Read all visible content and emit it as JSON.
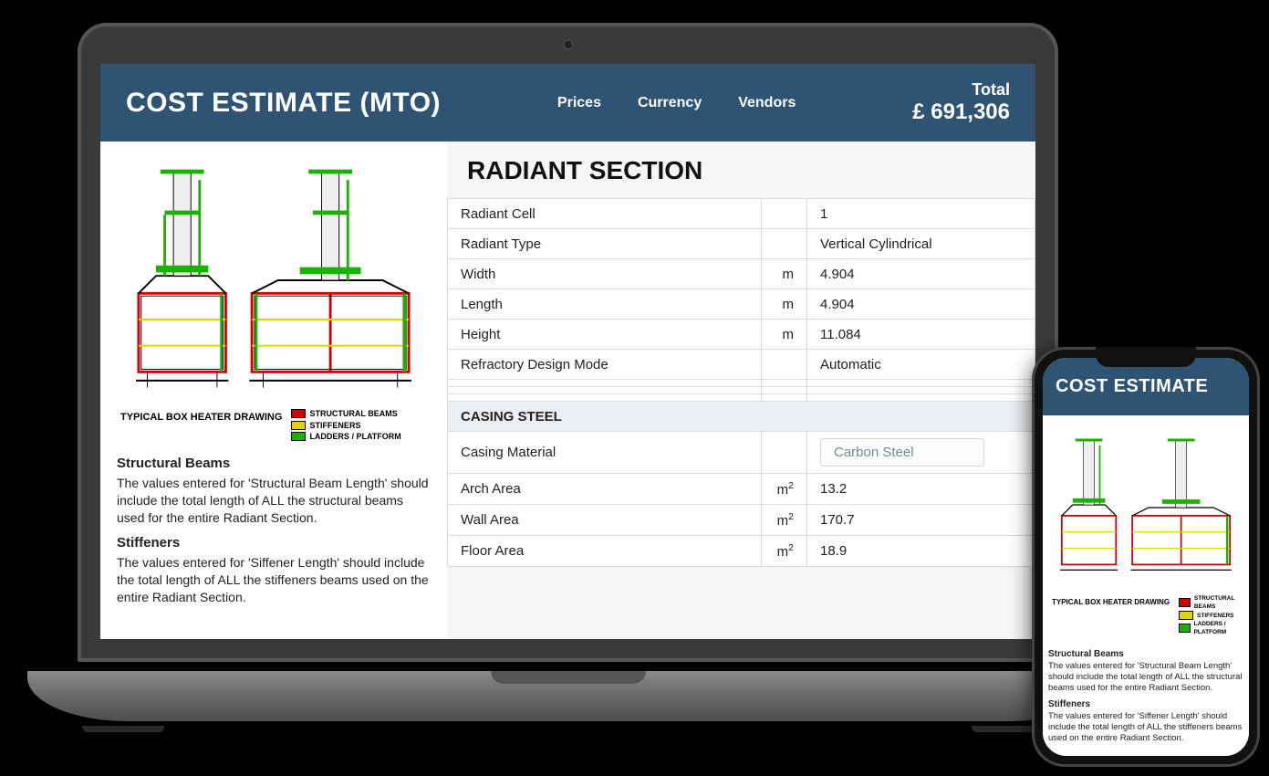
{
  "header": {
    "title": "COST ESTIMATE (MTO)",
    "title_short": "COST ESTIMATE",
    "nav": {
      "prices": "Prices",
      "currency": "Currency",
      "vendors": "Vendors"
    },
    "total_label": "Total",
    "total_value": "£ 691,306"
  },
  "drawing": {
    "caption": "TYPICAL BOX HEATER DRAWING",
    "legend": {
      "beams": "STRUCTURAL BEAMS",
      "stiffeners": "STIFFENERS",
      "ladders": "LADDERS / PLATFORM"
    },
    "colors": {
      "beams": "#d40000",
      "stiffeners": "#e0d400",
      "ladders": "#19b200"
    }
  },
  "help": {
    "beams_title": "Structural Beams",
    "beams_text": "The values entered for 'Structural Beam Length' should include the total length of ALL the structural beams used for the entire Radiant Section.",
    "stiff_title": "Stiffeners",
    "stiff_text": "The values entered for 'Siffener Length' should include the total length of ALL the stiffeners beams used on the entire Radiant Section."
  },
  "section": {
    "title": "RADIANT SECTION",
    "rows": [
      {
        "label": "Radiant Cell",
        "unit": "",
        "value": "1"
      },
      {
        "label": "Radiant Type",
        "unit": "",
        "value": "Vertical Cylindrical"
      },
      {
        "label": "Width",
        "unit": "m",
        "value": "4.904"
      },
      {
        "label": "Length",
        "unit": "m",
        "value": "4.904"
      },
      {
        "label": "Height",
        "unit": "m",
        "value": "11.084"
      },
      {
        "label": "Refractory Design Mode",
        "unit": "",
        "value": "Automatic"
      }
    ],
    "casing_title": "CASING STEEL",
    "casing_material_label": "Casing Material",
    "casing_material_value": "Carbon Steel",
    "casing_rows": [
      {
        "label": "Arch Area",
        "unit": "m²",
        "value": "13.2"
      },
      {
        "label": "Wall Area",
        "unit": "m²",
        "value": "170.7"
      },
      {
        "label": "Floor Area",
        "unit": "m²",
        "value": "18.9"
      }
    ]
  }
}
